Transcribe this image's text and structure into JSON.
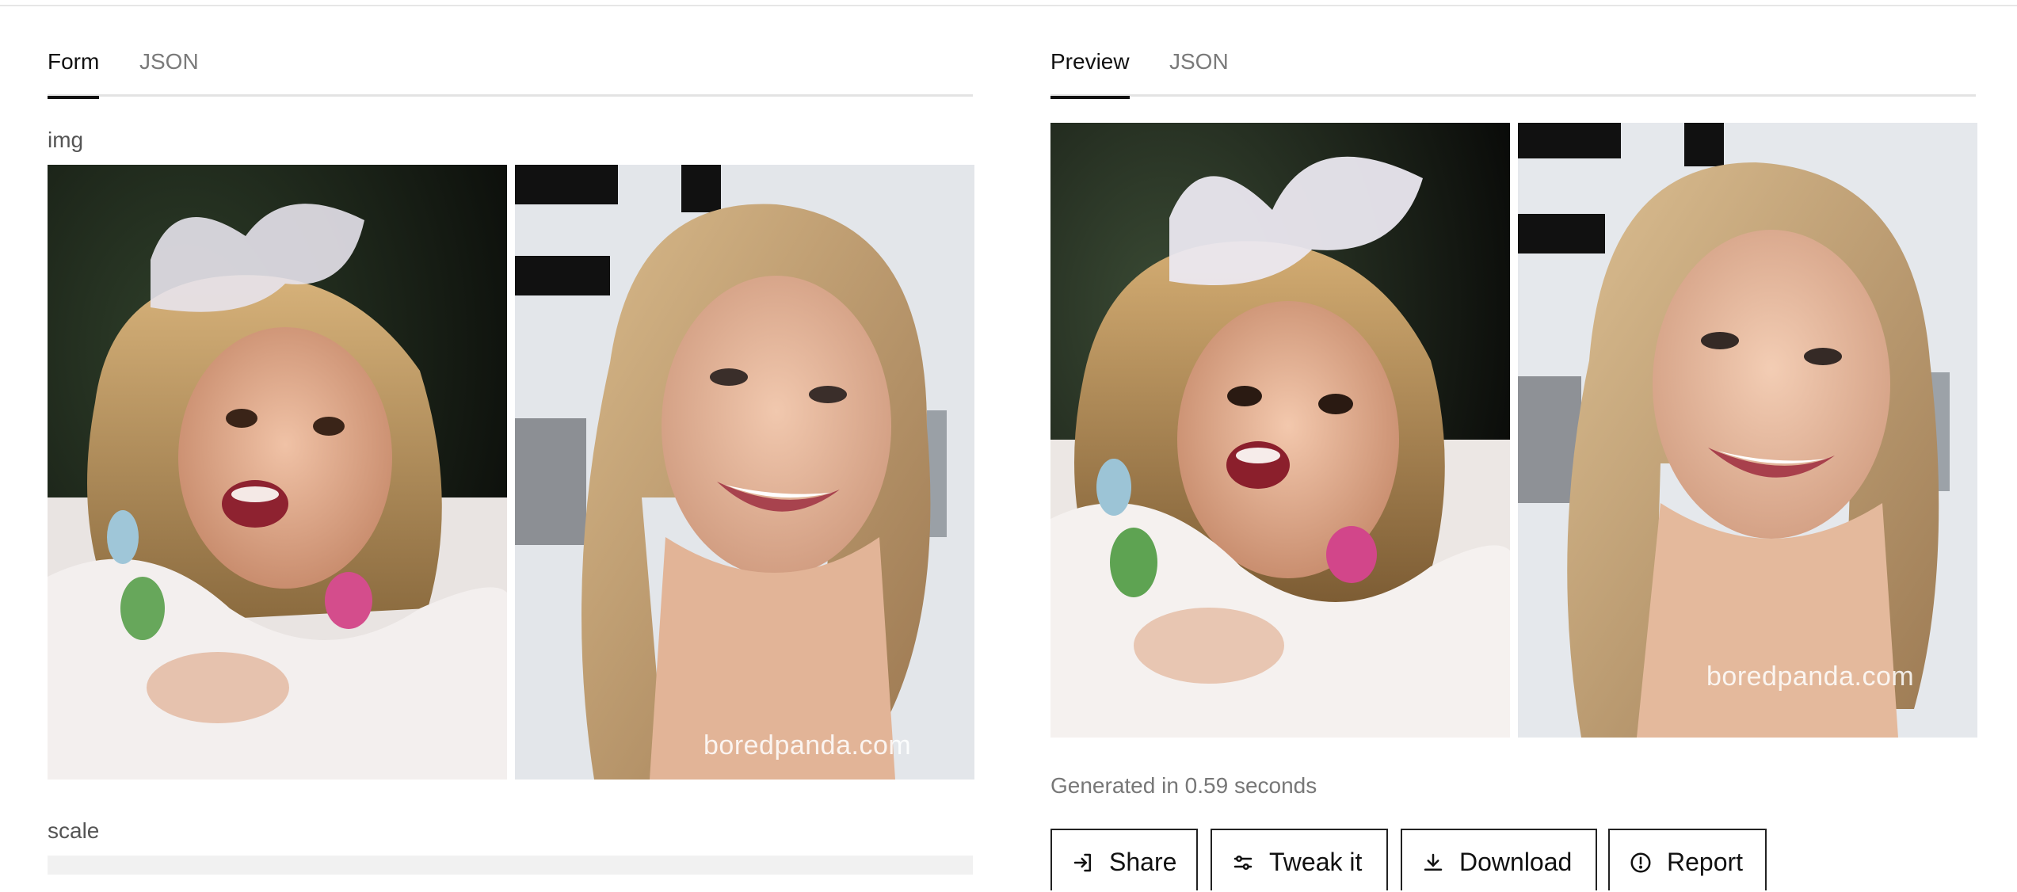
{
  "input_panel": {
    "tabs": [
      {
        "label": "Form",
        "active": true
      },
      {
        "label": "JSON",
        "active": false
      }
    ],
    "img_label": "img",
    "images": [
      {
        "description_icon": "child-photo",
        "watermark": ""
      },
      {
        "description_icon": "adult-photo",
        "watermark": "boredpanda.com"
      }
    ],
    "scale_label": "scale"
  },
  "output_panel": {
    "tabs": [
      {
        "label": "Preview",
        "active": true
      },
      {
        "label": "JSON",
        "active": false
      }
    ],
    "images": [
      {
        "description_icon": "restored-child-photo",
        "watermark": ""
      },
      {
        "description_icon": "restored-adult-photo",
        "watermark": "boredpanda.com"
      }
    ],
    "generated_text": "Generated in 0.59 seconds",
    "actions": [
      {
        "label": "Share",
        "icon": "share-icon"
      },
      {
        "label": "Tweak it",
        "icon": "sliders-icon"
      },
      {
        "label": "Download",
        "icon": "download-icon"
      },
      {
        "label": "Report",
        "icon": "alert-circle-icon"
      }
    ]
  }
}
